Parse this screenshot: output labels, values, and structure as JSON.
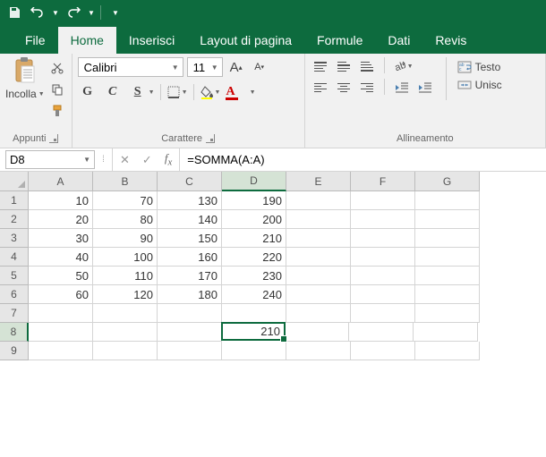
{
  "qat": {
    "save": "save",
    "undo": "undo",
    "redo": "redo"
  },
  "tabs": [
    "File",
    "Home",
    "Inserisci",
    "Layout di pagina",
    "Formule",
    "Dati",
    "Revis"
  ],
  "active_tab": 1,
  "ribbon": {
    "clipboard": {
      "label": "Appunti",
      "paste": "Incolla"
    },
    "font": {
      "label": "Carattere",
      "name": "Calibri",
      "size": "11",
      "bold": "G",
      "italic": "C",
      "underline": "S",
      "grow": "A",
      "shrink": "A"
    },
    "alignment": {
      "label": "Allineamento",
      "wrap": "Testo",
      "merge": "Unisc"
    }
  },
  "name_box": "D8",
  "formula": "=SOMMA(A:A)",
  "columns": [
    "A",
    "B",
    "C",
    "D",
    "E",
    "F",
    "G"
  ],
  "selected_col": 3,
  "selected_row": 7,
  "grid": [
    [
      "10",
      "70",
      "130",
      "190",
      "",
      "",
      ""
    ],
    [
      "20",
      "80",
      "140",
      "200",
      "",
      "",
      ""
    ],
    [
      "30",
      "90",
      "150",
      "210",
      "",
      "",
      ""
    ],
    [
      "40",
      "100",
      "160",
      "220",
      "",
      "",
      ""
    ],
    [
      "50",
      "110",
      "170",
      "230",
      "",
      "",
      ""
    ],
    [
      "60",
      "120",
      "180",
      "240",
      "",
      "",
      ""
    ],
    [
      "",
      "",
      "",
      "",
      "",
      "",
      ""
    ],
    [
      "",
      "",
      "",
      "210",
      "",
      "",
      ""
    ],
    [
      "",
      "",
      "",
      "",
      "",
      "",
      ""
    ]
  ],
  "chart_data": {
    "type": "table",
    "title": "Spreadsheet data with SUM formula",
    "columns": [
      "A",
      "B",
      "C",
      "D"
    ],
    "rows": [
      [
        10,
        70,
        130,
        190
      ],
      [
        20,
        80,
        140,
        200
      ],
      [
        30,
        90,
        150,
        210
      ],
      [
        40,
        100,
        160,
        220
      ],
      [
        50,
        110,
        170,
        230
      ],
      [
        60,
        120,
        180,
        240
      ]
    ],
    "formula_cell": {
      "address": "D8",
      "formula": "=SOMMA(A:A)",
      "value": 210
    }
  }
}
